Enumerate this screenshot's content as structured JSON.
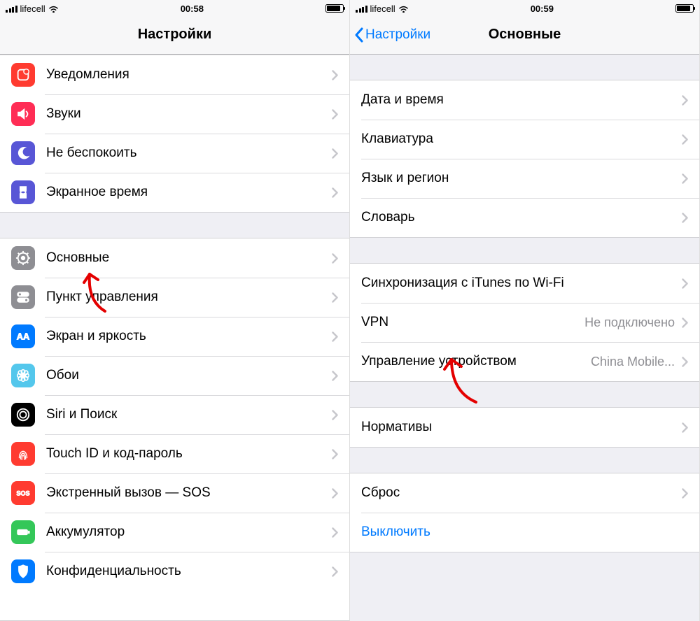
{
  "status": {
    "carrier": "lifecell",
    "time_left": "00:58",
    "time_right": "00:59"
  },
  "left": {
    "title": "Настройки",
    "group1": [
      {
        "label": "Уведомления",
        "icon": "notifications",
        "bg": "#ff3b30"
      },
      {
        "label": "Звуки",
        "icon": "sounds",
        "bg": "#ff2d55"
      },
      {
        "label": "Не беспокоить",
        "icon": "dnd",
        "bg": "#5856d6"
      },
      {
        "label": "Экранное время",
        "icon": "screentime",
        "bg": "#5856d6"
      }
    ],
    "group2": [
      {
        "label": "Основные",
        "icon": "general",
        "bg": "#8e8e93"
      },
      {
        "label": "Пункт управления",
        "icon": "controlcenter",
        "bg": "#8e8e93"
      },
      {
        "label": "Экран и яркость",
        "icon": "display",
        "bg": "#007aff"
      },
      {
        "label": "Обои",
        "icon": "wallpaper",
        "bg": "#54c7ec"
      },
      {
        "label": "Siri и Поиск",
        "icon": "siri",
        "bg": "#000000"
      },
      {
        "label": "Touch ID и код-пароль",
        "icon": "touchid",
        "bg": "#ff3b30"
      },
      {
        "label": "Экстренный вызов — SOS",
        "icon": "sos",
        "bg": "#ff3b30"
      },
      {
        "label": "Аккумулятор",
        "icon": "battery",
        "bg": "#34c759"
      },
      {
        "label": "Конфиденциальность",
        "icon": "privacy",
        "bg": "#007aff"
      }
    ]
  },
  "right": {
    "back": "Настройки",
    "title": "Основные",
    "group1": [
      {
        "label": "Дата и время"
      },
      {
        "label": "Клавиатура"
      },
      {
        "label": "Язык и регион"
      },
      {
        "label": "Словарь"
      }
    ],
    "group2": [
      {
        "label": "Синхронизация с iTunes по Wi-Fi"
      },
      {
        "label": "VPN",
        "detail": "Не подключено"
      },
      {
        "label": "Управление устройством",
        "detail": "China Mobile..."
      }
    ],
    "group3": [
      {
        "label": "Нормативы"
      }
    ],
    "group4": [
      {
        "label": "Сброс"
      },
      {
        "label": "Выключить",
        "link": true,
        "no_chevron": true
      }
    ]
  }
}
